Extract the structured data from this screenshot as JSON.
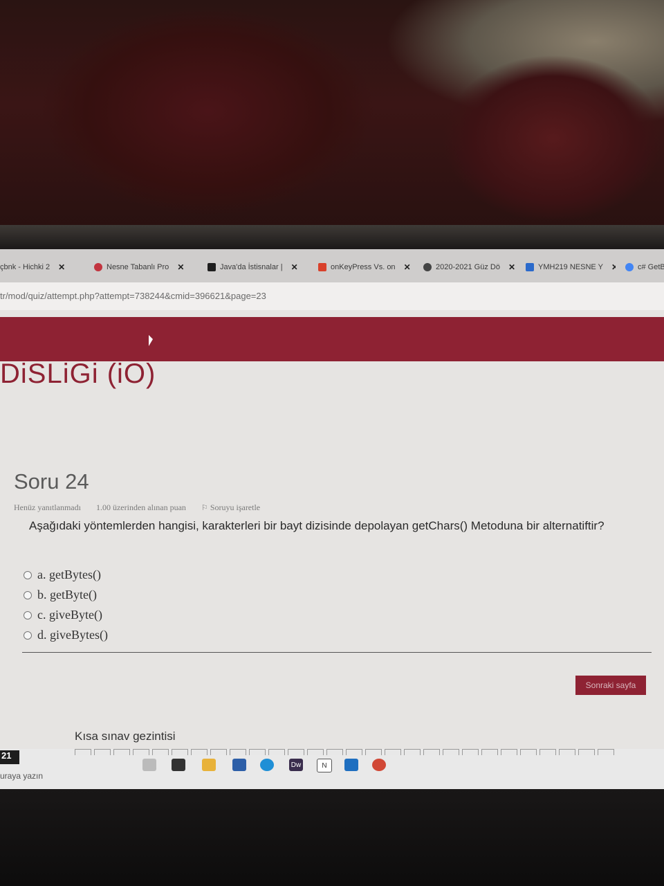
{
  "browser": {
    "tabs": [
      {
        "label": "çbnk - Hichki 2",
        "icon": "page-icon",
        "color": "#8a8a8a"
      },
      {
        "label": "Nesne Tabanlı Pro",
        "icon": "moodle-icon",
        "color": "#c2343f"
      },
      {
        "label": "Java'da İstisnalar |",
        "icon": "cc-icon",
        "color": "#1e1e1e"
      },
      {
        "label": "onKeyPress Vs. on",
        "icon": "qa-icon",
        "color": "#d9412b"
      },
      {
        "label": "2020-2021 Güz Dö",
        "icon": "globe-icon",
        "color": "#444"
      },
      {
        "label": "YMH219 NESNE Y",
        "icon": "classroom-icon",
        "color": "#2b6acb"
      },
      {
        "label": "c# GetB",
        "icon": "google-icon",
        "color": "#4285f4"
      }
    ],
    "close_symbol": "✕",
    "url": "tr/mod/quiz/attempt.php?attempt=738244&cmid=396621&page=23"
  },
  "course": {
    "title": "DiSLiGi (iO)"
  },
  "question": {
    "heading": "Soru 24",
    "status": "Henüz yanıtlanmadı",
    "points": "1.00 üzerinden alınan puan",
    "flag_label": "Soruyu işaretle",
    "text": "Aşağıdaki yöntemlerden hangisi, karakterleri bir bayt dizisinde depolayan getChars() Metoduna bir alternatiftir?",
    "options": [
      {
        "label": "a. getBytes()"
      },
      {
        "label": "b. getByte()"
      },
      {
        "label": "c. giveByte()"
      },
      {
        "label": "d. giveBytes()"
      }
    ]
  },
  "actions": {
    "next_label": "Sonraki sayfa"
  },
  "navigation": {
    "title": "Kısa sınav gezintisi"
  },
  "taskbar": {
    "time_fragment": "21",
    "search_placeholder": "uraya yazın",
    "apps": [
      "task-view-icon",
      "store-icon",
      "file-explorer-icon",
      "mail-icon",
      "edge-icon",
      "dreamweaver-icon",
      "onenote-icon",
      "outlook-icon",
      "chrome-icon"
    ],
    "dreamweaver_label": "Dw",
    "onenote_label": "N"
  },
  "colors": {
    "accent": "#8e2233"
  }
}
